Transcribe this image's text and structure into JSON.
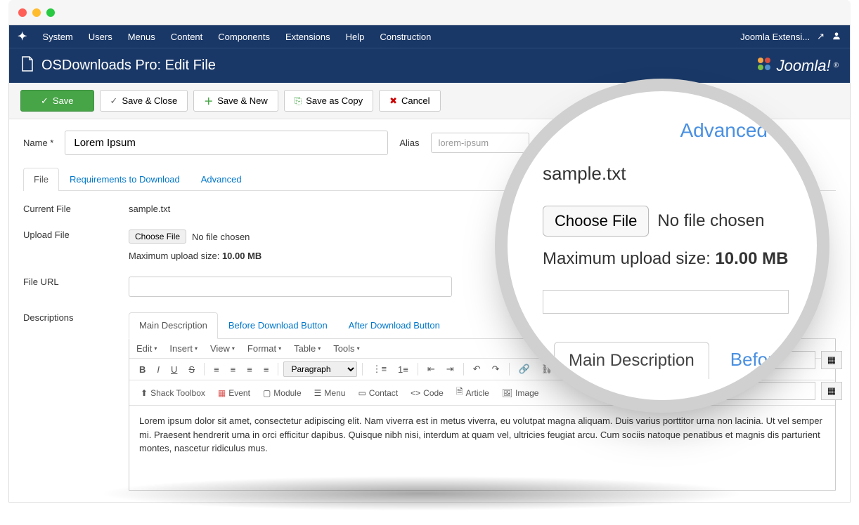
{
  "topmenu": {
    "items": [
      "System",
      "Users",
      "Menus",
      "Content",
      "Components",
      "Extensions",
      "Help",
      "Construction"
    ],
    "site_name": "Joomla Extensi...",
    "external_icon": "↗",
    "user_icon": "👤"
  },
  "header": {
    "icon": "file-icon",
    "title": "OSDownloads Pro: Edit File",
    "logo_text": "Joomla!"
  },
  "toolbar": {
    "save": "Save",
    "save_close": "Save & Close",
    "save_new": "Save & New",
    "save_copy": "Save as Copy",
    "cancel": "Cancel"
  },
  "form": {
    "name_label": "Name *",
    "name_value": "Lorem Ipsum",
    "alias_label": "Alias",
    "alias_value": "lorem-ipsum"
  },
  "tabs": {
    "file": "File",
    "req": "Requirements to Download",
    "adv": "Advanced"
  },
  "fields": {
    "current_file_label": "Current File",
    "current_file_value": "sample.txt",
    "upload_label": "Upload File",
    "choose_btn": "Choose File",
    "no_file": "No file chosen",
    "max_upload_prefix": "Maximum upload size: ",
    "max_upload_value": "10.00 MB",
    "url_label": "File URL",
    "desc_label": "Descriptions"
  },
  "desc_tabs": {
    "main": "Main Description",
    "before": "Before Download Button",
    "after": "After Download Button"
  },
  "editor": {
    "menu": {
      "edit": "Edit",
      "insert": "Insert",
      "view": "View",
      "format": "Format",
      "table": "Table",
      "tools": "Tools"
    },
    "paragraph": "Paragraph",
    "toolbar2": {
      "shack": "Shack Toolbox",
      "event": "Event",
      "module": "Module",
      "menu": "Menu",
      "contact": "Contact",
      "code": "Code",
      "article": "Article",
      "image": "Image"
    },
    "content": "Lorem ipsum dolor sit amet, consectetur adipiscing elit. Nam viverra est in metus viverra, eu volutpat magna aliquam. Duis varius porttitor urna non lacinia. Ut vel semper mi. Praesent hendrerit urna in orci efficitur dapibus. Quisque nibh nisi, interdum at quam vel, ultricies feugiat arcu. Cum sociis natoque penatibus et magnis dis parturient montes, nascetur ridiculus mus."
  },
  "magnifier": {
    "advanced": "Advanced",
    "sample": "sample.txt",
    "choose": "Choose File",
    "nofile": "No file chosen",
    "max_prefix": "Maximum upload size: ",
    "max_value": "10.00 MB",
    "main_desc": "Main Description",
    "before": "Before"
  }
}
